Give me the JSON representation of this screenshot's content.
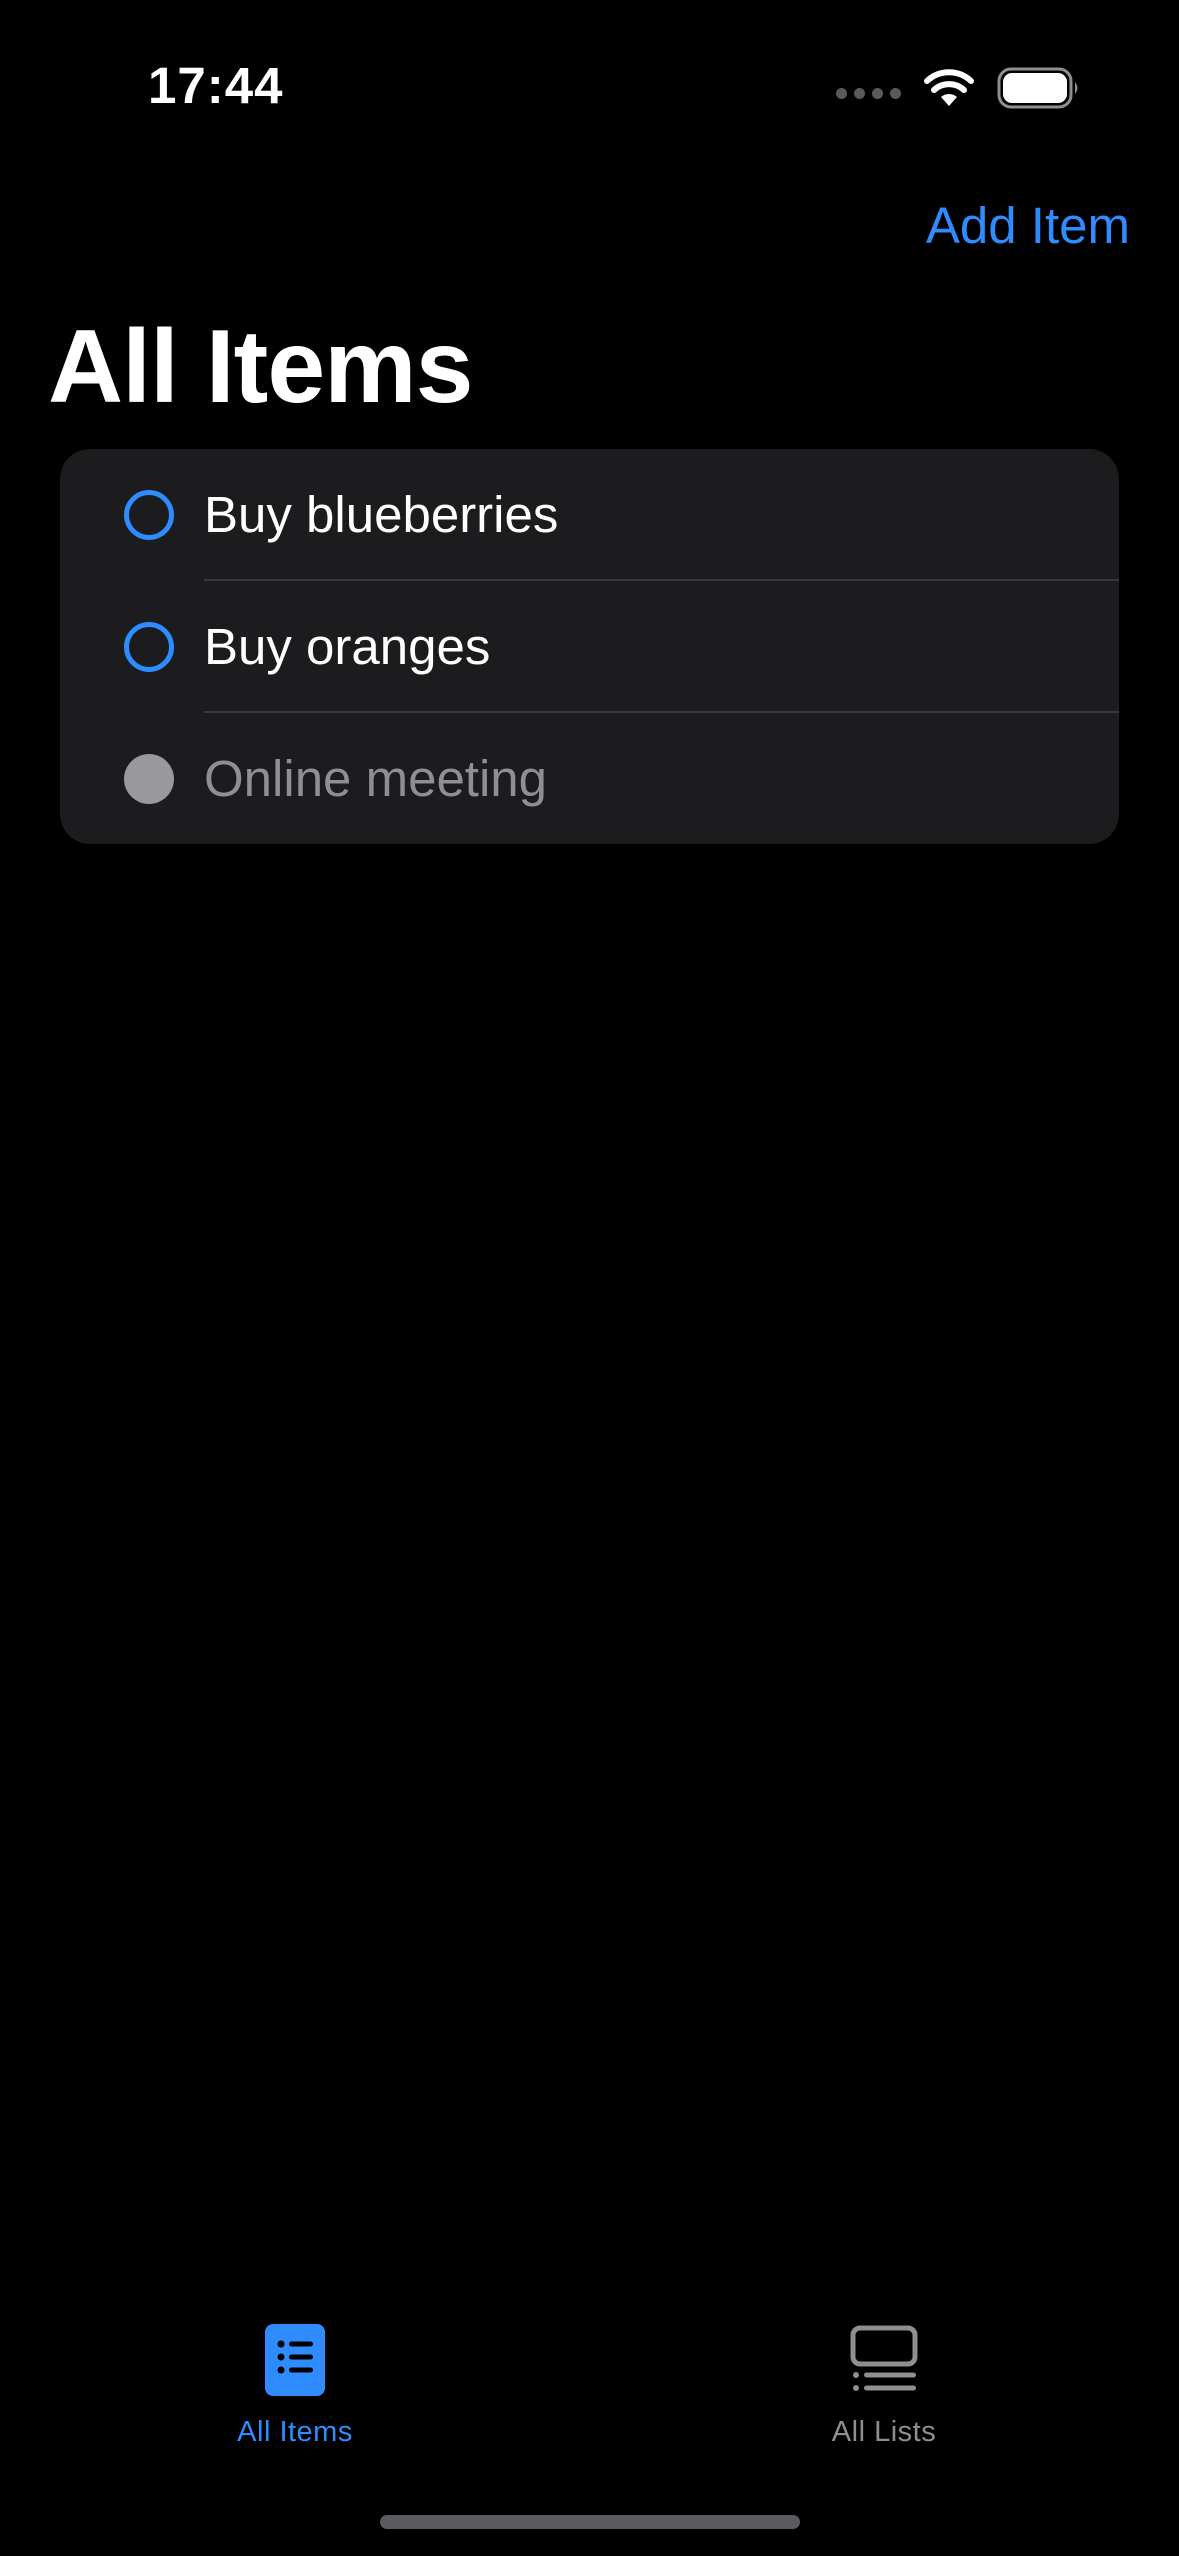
{
  "status_bar": {
    "time": "17:44"
  },
  "nav": {
    "add_item_label": "Add Item",
    "title": "All Items"
  },
  "items": [
    {
      "label": "Buy blueberries",
      "completed": false
    },
    {
      "label": "Buy oranges",
      "completed": false
    },
    {
      "label": "Online meeting",
      "completed": true
    }
  ],
  "tab_bar": {
    "tabs": [
      {
        "label": "All Items",
        "icon": "list-bullet-icon",
        "selected": true
      },
      {
        "label": "All Lists",
        "icon": "rectangle-list-icon",
        "selected": false
      }
    ]
  },
  "colors": {
    "accent": "#2f8cff",
    "background": "#000000",
    "card": "#1c1c1e",
    "secondary_text": "#8e8e93"
  }
}
